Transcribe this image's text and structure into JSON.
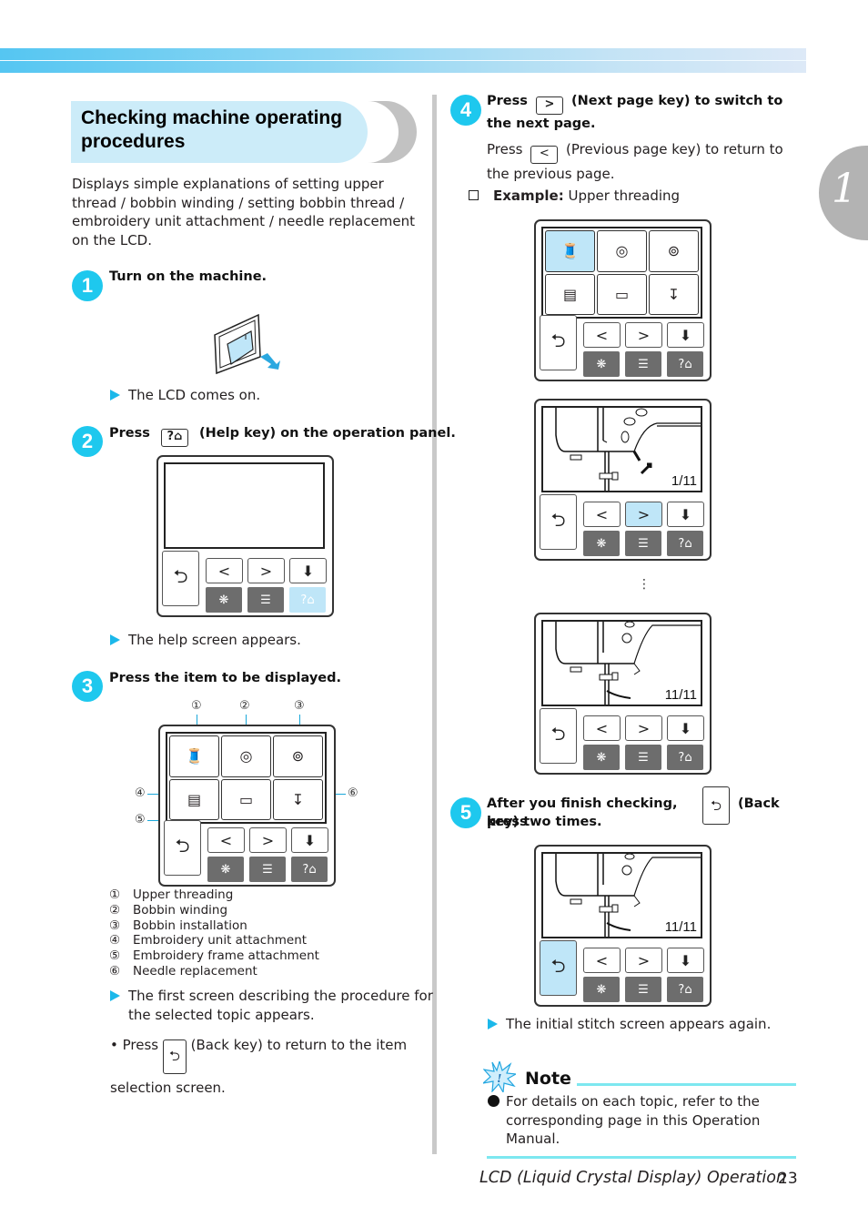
{
  "chapter_tab": "1",
  "section_title": "Checking machine operating procedures",
  "intro": "Displays simple explanations of setting upper thread / bobbin winding / setting bobbin thread / embroidery unit attachment / needle replacement on the LCD.",
  "steps": [
    {
      "number": "1",
      "title": "Turn on the machine.",
      "result": "The LCD comes on."
    },
    {
      "number": "2",
      "title_prefix": "Press",
      "key_icon": "help-key-icon",
      "title_suffix": "(Help key) on the operation panel.",
      "result": "The help screen appears."
    },
    {
      "number": "3",
      "title": "Press the item to be displayed.",
      "result": "The first screen describing the procedure for the selected topic appears.",
      "bullet_prefix": "• Press",
      "bullet_suffix": "(Back key) to return to the item selection screen."
    },
    {
      "number": "4",
      "title_prefix": "Press",
      "title_suffix": "(Next page key) to switch to the next page.",
      "sub_prefix": "Press",
      "sub_suffix": "(Previous page key) to return to the previous page.",
      "example_label": "Example:",
      "example_value": "Upper threading"
    },
    {
      "number": "5",
      "title_prefix": "After you finish checking, press",
      "title_suffix_a": "(Back",
      "title_suffix_b": "key) two times.",
      "result": "The initial stitch screen appears again."
    }
  ],
  "topics": [
    {
      "n": "①",
      "label": "Upper threading"
    },
    {
      "n": "②",
      "label": "Bobbin winding"
    },
    {
      "n": "③",
      "label": "Bobbin installation"
    },
    {
      "n": "④",
      "label": "Embroidery unit attachment"
    },
    {
      "n": "⑤",
      "label": "Embroidery frame attachment"
    },
    {
      "n": "⑥",
      "label": "Needle replacement"
    }
  ],
  "lcd_keys": {
    "back": "⮌",
    "prev": "<",
    "next": ">",
    "help": "?⌂"
  },
  "lcd_pages": {
    "first": "1/11",
    "last": "11/11"
  },
  "ellipsis": "⋮",
  "note": {
    "heading": "Note",
    "text": "For details on each topic, refer to the corresponding page in this Operation Manual."
  },
  "footer": {
    "title": "LCD (Liquid Crystal Display) Operation",
    "page": "23"
  },
  "colors": {
    "accent": "#1ec8ee",
    "highlight": "#bfe6f8",
    "title_bg": "#ccecf9",
    "dark_key": "#6d6d6d"
  }
}
